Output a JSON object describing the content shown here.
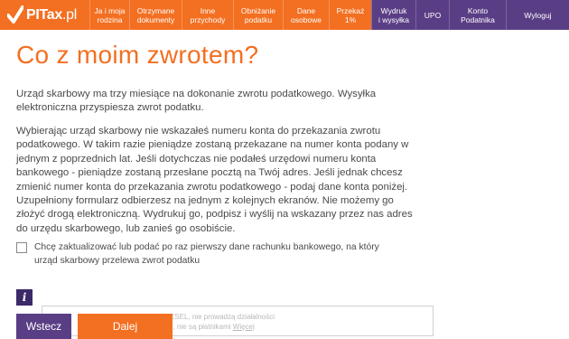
{
  "brand": {
    "logo_main": "PITax",
    "logo_suffix": ".pl"
  },
  "nav": [
    {
      "label": "Ja i moja\nrodzina"
    },
    {
      "label": "Otrzymane\ndokumenty"
    },
    {
      "label": "Inne\nprzychody"
    },
    {
      "label": "Obniżanie\npodatku"
    },
    {
      "label": "Dane\nosobowe"
    },
    {
      "label": "Przekaż\n1%"
    },
    {
      "label": "Wydruk\ni wysyłka"
    },
    {
      "label": "UPO"
    },
    {
      "label": "Konto\nPodatnika"
    },
    {
      "label": "Wyloguj"
    }
  ],
  "page": {
    "title": "Co z moim zwrotem?",
    "paragraph1": "Urząd skarbowy ma trzy miesiące na dokonanie zwrotu podatkowego. Wysyłka elektroniczna przyspiesza zwrot podatku.",
    "paragraph2": "Wybierając urząd skarbowy nie wskazałeś numeru konta do przekazania zwrotu podatkowego. W takim razie pieniądze zostaną przekazane na numer konta podany w jednym z poprzednich lat. Jeśli dotychczas nie podałeś urzędowi numeru konta bankowego - pieniądze zostaną przesłane pocztą na Twój adres. Jeśli jednak chcesz zmienić numer konta do przekazania zwrotu podatkowego - podaj dane konta poniżej. Uzupełniony formularz odbierzesz na jednym z kolejnych ekranów. Nie możemy go złożyć drogą elektroniczną. Wydrukuj go, podpisz i wyślij na wskazany przez nas adres do urzędu skarbowego, lub zanieś go osobiście.",
    "checkbox_label": "Chcę zaktualizować lub podać po raz pierwszy dane rachunku bankowego, na który urząd skarbowy przelewa zwrot podatku",
    "checkbox_checked": false,
    "info_symbol": "i"
  },
  "notice": {
    "line1": "osób, które są objęte nr. PESEL, nie prowadzą działalności",
    "line2": "T.nie są płatnikami podatku, nie są płatnikami",
    "more_link": "Więcej"
  },
  "buttons": {
    "back": "Wstecz",
    "next": "Dalej"
  },
  "colors": {
    "accent": "#f36f21",
    "secondary": "#5a3e85",
    "text": "#4a4a4a"
  }
}
